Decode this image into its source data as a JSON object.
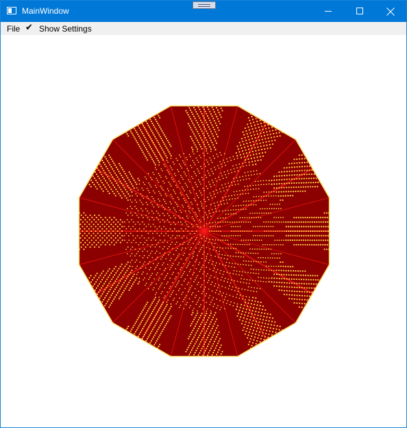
{
  "window": {
    "title": "MainWindow",
    "icons": {
      "app": "app-window-icon",
      "minimize": "minimize-icon",
      "maximize": "maximize-icon",
      "close": "close-icon",
      "grip": "drag-grip-icon"
    },
    "colors": {
      "titlebar": "#0078d7",
      "menubar": "#f0f0f0"
    }
  },
  "menu": {
    "file_label": "File",
    "check_icon": "✔",
    "settings_label": "Show Settings",
    "settings_checked": true
  },
  "render": {
    "shape": "dodecagon",
    "colors": {
      "background": "#8b0000",
      "dots": "#ffd24a",
      "rays": "#ff1a1a",
      "outline": "#ffe066"
    }
  }
}
